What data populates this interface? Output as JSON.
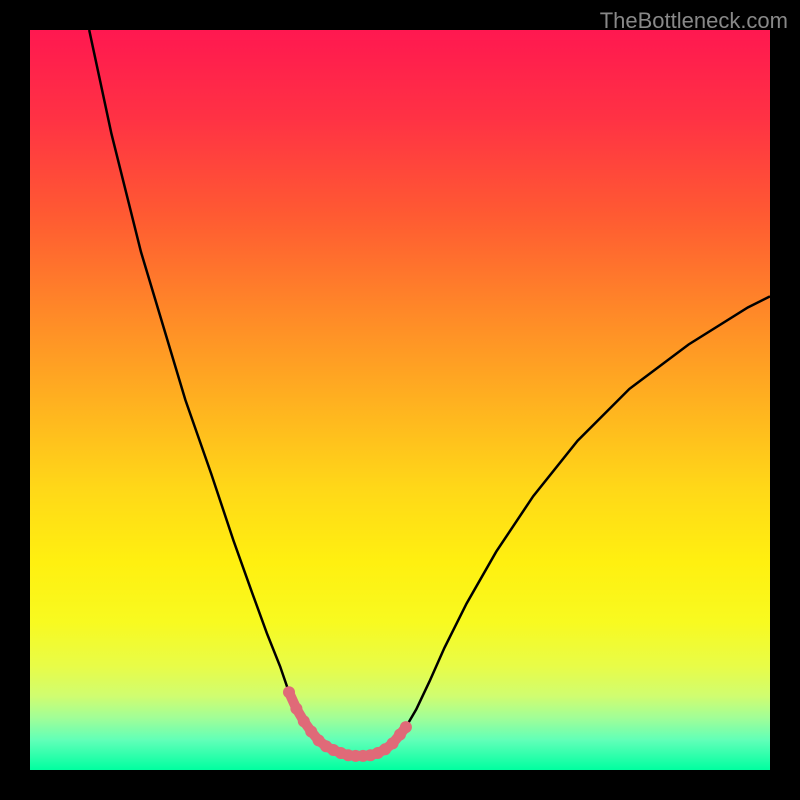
{
  "watermark": "TheBottleneck.com",
  "chart_data": {
    "type": "line",
    "title": "",
    "xlabel": "",
    "ylabel": "",
    "x_range": [
      0,
      1
    ],
    "y_range": [
      0,
      1
    ],
    "series": [
      {
        "name": "curve",
        "x": [
          0.08,
          0.095,
          0.11,
          0.13,
          0.15,
          0.18,
          0.21,
          0.245,
          0.275,
          0.3,
          0.32,
          0.338,
          0.35,
          0.362,
          0.374,
          0.386,
          0.398,
          0.41,
          0.422,
          0.434,
          0.446,
          0.458,
          0.47,
          0.482,
          0.495,
          0.508,
          0.522,
          0.54,
          0.56,
          0.59,
          0.63,
          0.68,
          0.74,
          0.81,
          0.89,
          0.97,
          1.0
        ],
        "y": [
          1.0,
          0.93,
          0.86,
          0.78,
          0.7,
          0.6,
          0.5,
          0.4,
          0.31,
          0.24,
          0.185,
          0.14,
          0.105,
          0.078,
          0.058,
          0.044,
          0.034,
          0.027,
          0.022,
          0.02,
          0.019,
          0.02,
          0.023,
          0.029,
          0.04,
          0.058,
          0.082,
          0.12,
          0.165,
          0.225,
          0.295,
          0.37,
          0.445,
          0.515,
          0.575,
          0.625,
          0.64
        ]
      },
      {
        "name": "highlight",
        "x": [
          0.35,
          0.36,
          0.37,
          0.38,
          0.39,
          0.4,
          0.41,
          0.42,
          0.43,
          0.44,
          0.45,
          0.46,
          0.47,
          0.48,
          0.49,
          0.5,
          0.508
        ],
        "y": [
          0.105,
          0.083,
          0.066,
          0.052,
          0.04,
          0.032,
          0.027,
          0.023,
          0.02,
          0.019,
          0.019,
          0.02,
          0.023,
          0.028,
          0.036,
          0.048,
          0.058
        ]
      }
    ],
    "gradient_stops": [
      {
        "offset": 0.0,
        "color": "#ff1850"
      },
      {
        "offset": 0.12,
        "color": "#ff3244"
      },
      {
        "offset": 0.25,
        "color": "#ff5a32"
      },
      {
        "offset": 0.38,
        "color": "#ff8828"
      },
      {
        "offset": 0.5,
        "color": "#ffb020"
      },
      {
        "offset": 0.62,
        "color": "#ffd818"
      },
      {
        "offset": 0.72,
        "color": "#fff010"
      },
      {
        "offset": 0.8,
        "color": "#f8fa20"
      },
      {
        "offset": 0.86,
        "color": "#e8fc48"
      },
      {
        "offset": 0.9,
        "color": "#d0fd70"
      },
      {
        "offset": 0.93,
        "color": "#a0fe98"
      },
      {
        "offset": 0.96,
        "color": "#60ffb8"
      },
      {
        "offset": 1.0,
        "color": "#00ffa0"
      }
    ],
    "highlight_color": "#e06a78",
    "curve_color": "#000000"
  }
}
